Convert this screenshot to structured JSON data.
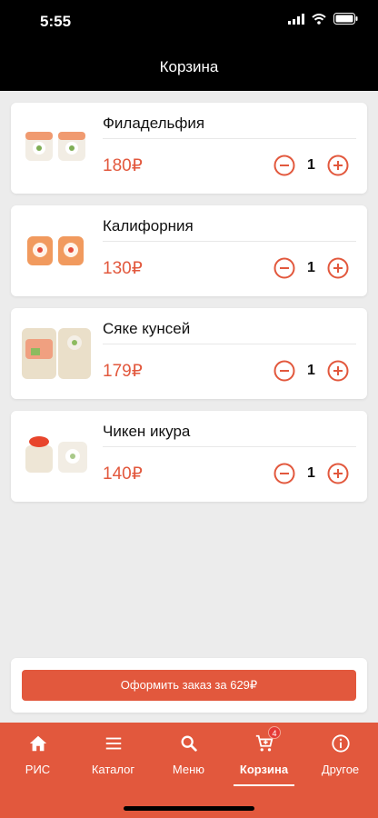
{
  "status": {
    "time": "5:55"
  },
  "header": {
    "title": "Корзина"
  },
  "cart": {
    "items": [
      {
        "name": "Филадельфия",
        "price": "180₽",
        "quantity": "1"
      },
      {
        "name": "Калифорния",
        "price": "130₽",
        "quantity": "1"
      },
      {
        "name": "Сяке кунсей",
        "price": "179₽",
        "quantity": "1"
      },
      {
        "name": "Чикен икура",
        "price": "140₽",
        "quantity": "1"
      }
    ]
  },
  "checkout": {
    "label": "Оформить заказ за 629₽"
  },
  "tabs": [
    {
      "label": "РИС",
      "icon": "home-icon"
    },
    {
      "label": "Каталог",
      "icon": "menu-icon"
    },
    {
      "label": "Меню",
      "icon": "search-icon"
    },
    {
      "label": "Корзина",
      "icon": "cart-icon",
      "badge": "4"
    },
    {
      "label": "Другое",
      "icon": "info-icon"
    }
  ],
  "colors": {
    "accent": "#e2583d",
    "header": "#000000",
    "background": "#ececec"
  }
}
